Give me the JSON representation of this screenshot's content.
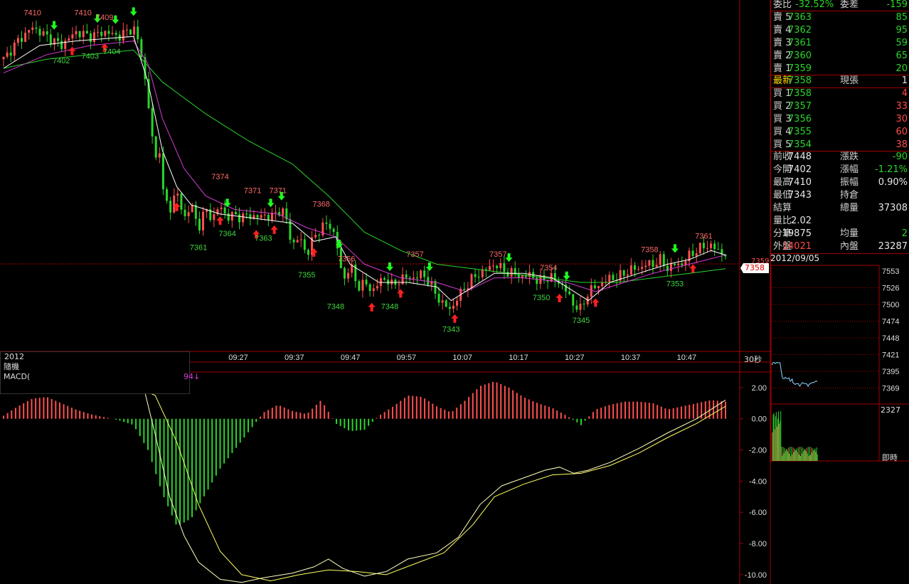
{
  "header": {
    "year": "2012",
    "thirty_sec": "30秒",
    "popup_line1": "隨機",
    "popup_line2": "MACD(",
    "macd_tail": "94↓"
  },
  "sidebar": {
    "top_row": {
      "label": "委比",
      "value": "-32.52%",
      "label2": "委差",
      "value2": "-159"
    },
    "sell": [
      {
        "label": "賣 5",
        "price": "7363",
        "vol": "85"
      },
      {
        "label": "賣 4",
        "price": "7362",
        "vol": "95"
      },
      {
        "label": "賣 3",
        "price": "7361",
        "vol": "59"
      },
      {
        "label": "賣 2",
        "price": "7360",
        "vol": "65"
      },
      {
        "label": "賣 1",
        "price": "7359",
        "vol": "20"
      }
    ],
    "latest": {
      "label": "最新",
      "price": "7358",
      "label2": "現張",
      "vol": "1"
    },
    "buy": [
      {
        "label": "買 1",
        "price": "7358",
        "vol": "4"
      },
      {
        "label": "買 2",
        "price": "7357",
        "vol": "33"
      },
      {
        "label": "買 3",
        "price": "7356",
        "vol": "30"
      },
      {
        "label": "買 4",
        "price": "7355",
        "vol": "60"
      },
      {
        "label": "買 5",
        "price": "7354",
        "vol": "38"
      }
    ],
    "stats": [
      {
        "l1": "前收",
        "v1": "7448",
        "l2": "漲跌",
        "v2": "-90"
      },
      {
        "l1": "今開",
        "v1": "7402",
        "l2": "漲幅",
        "v2": "-1.21%"
      },
      {
        "l1": "最高",
        "v1": "7410",
        "l2": "振幅",
        "v2": "0.90%"
      },
      {
        "l1": "最低",
        "v1": "7343",
        "l2": "持倉",
        "v2": ""
      },
      {
        "l1": "結算",
        "v1": "",
        "l2": "總量",
        "v2": "37308"
      },
      {
        "l1": "量比",
        "v1": "2.02",
        "l2": "",
        "v2": ""
      },
      {
        "l1": "分筆",
        "v1": "19875",
        "l2": "均量",
        "v2": "2"
      },
      {
        "l1": "外盤",
        "v1": "14021",
        "l2": "內盤",
        "v2": "23287"
      }
    ],
    "date": "2012/09/05",
    "mini_ticks": [
      "7553",
      "7526",
      "7500",
      "7474",
      "7448",
      "7421",
      "7395",
      "7369"
    ],
    "mini_vol": "2327",
    "mini_label": "即時"
  },
  "chart_data": {
    "type": "candlestick",
    "price_axis": {
      "ylim": [
        7337,
        7414
      ]
    },
    "current_price_label": "7358",
    "current_price_label2": "7359",
    "time_labels": [
      "09:27",
      "09:37",
      "09:47",
      "09:57",
      "10:07",
      "10:17",
      "10:27",
      "10:37",
      "10:47"
    ],
    "price_annotations": [
      {
        "t": 0.04,
        "v": 7410,
        "text": "7410",
        "pos": "top"
      },
      {
        "t": 0.11,
        "v": 7410,
        "text": "7410",
        "pos": "top"
      },
      {
        "t": 0.14,
        "v": 7409,
        "text": "7409",
        "pos": "top"
      },
      {
        "t": 0.08,
        "v": 7402,
        "text": "7402",
        "pos": "bottom"
      },
      {
        "t": 0.12,
        "v": 7403,
        "text": "7403",
        "pos": "bottom"
      },
      {
        "t": 0.15,
        "v": 7404,
        "text": "7404",
        "pos": "bottom"
      },
      {
        "t": 0.3,
        "v": 7374,
        "text": "7374",
        "pos": "top"
      },
      {
        "t": 0.27,
        "v": 7361,
        "text": "7361",
        "pos": "bottom"
      },
      {
        "t": 0.31,
        "v": 7364,
        "text": "7364",
        "pos": "bottom"
      },
      {
        "t": 0.345,
        "v": 7371,
        "text": "7371",
        "pos": "top"
      },
      {
        "t": 0.38,
        "v": 7371,
        "text": "7371",
        "pos": "top"
      },
      {
        "t": 0.36,
        "v": 7363,
        "text": "7363",
        "pos": "bottom"
      },
      {
        "t": 0.44,
        "v": 7368,
        "text": "7368",
        "pos": "top"
      },
      {
        "t": 0.42,
        "v": 7355,
        "text": "7355",
        "pos": "bottom"
      },
      {
        "t": 0.475,
        "v": 7356,
        "text": "7356",
        "pos": "top"
      },
      {
        "t": 0.46,
        "v": 7348,
        "text": "7348",
        "pos": "bottom"
      },
      {
        "t": 0.535,
        "v": 7348,
        "text": "7348",
        "pos": "bottom"
      },
      {
        "t": 0.57,
        "v": 7357,
        "text": "7357",
        "pos": "top"
      },
      {
        "t": 0.62,
        "v": 7343,
        "text": "7343",
        "pos": "bottom"
      },
      {
        "t": 0.685,
        "v": 7357,
        "text": "7357",
        "pos": "top"
      },
      {
        "t": 0.755,
        "v": 7354,
        "text": "7354",
        "pos": "top"
      },
      {
        "t": 0.745,
        "v": 7350,
        "text": "7350",
        "pos": "bottom"
      },
      {
        "t": 0.8,
        "v": 7345,
        "text": "7345",
        "pos": "bottom"
      },
      {
        "t": 0.895,
        "v": 7358,
        "text": "7358",
        "pos": "top"
      },
      {
        "t": 0.93,
        "v": 7353,
        "text": "7353",
        "pos": "bottom"
      },
      {
        "t": 0.97,
        "v": 7361,
        "text": "7361",
        "pos": "top"
      }
    ],
    "price_path": [
      [
        0.0,
        7401
      ],
      [
        0.02,
        7405
      ],
      [
        0.04,
        7408
      ],
      [
        0.06,
        7406
      ],
      [
        0.08,
        7404
      ],
      [
        0.1,
        7407
      ],
      [
        0.12,
        7406
      ],
      [
        0.14,
        7407
      ],
      [
        0.16,
        7406
      ],
      [
        0.18,
        7408
      ],
      [
        0.19,
        7403
      ],
      [
        0.2,
        7392
      ],
      [
        0.205,
        7385
      ],
      [
        0.21,
        7378
      ],
      [
        0.215,
        7384
      ],
      [
        0.22,
        7372
      ],
      [
        0.23,
        7368
      ],
      [
        0.24,
        7372
      ],
      [
        0.25,
        7366
      ],
      [
        0.26,
        7369
      ],
      [
        0.27,
        7364
      ],
      [
        0.28,
        7368
      ],
      [
        0.29,
        7366
      ],
      [
        0.3,
        7369
      ],
      [
        0.31,
        7366
      ],
      [
        0.32,
        7367
      ],
      [
        0.33,
        7366
      ],
      [
        0.34,
        7367
      ],
      [
        0.35,
        7366
      ],
      [
        0.36,
        7367
      ],
      [
        0.37,
        7366
      ],
      [
        0.38,
        7368
      ],
      [
        0.39,
        7367
      ],
      [
        0.4,
        7360
      ],
      [
        0.41,
        7362
      ],
      [
        0.42,
        7358
      ],
      [
        0.43,
        7362
      ],
      [
        0.44,
        7364
      ],
      [
        0.45,
        7365
      ],
      [
        0.46,
        7362
      ],
      [
        0.47,
        7352
      ],
      [
        0.48,
        7356
      ],
      [
        0.49,
        7351
      ],
      [
        0.5,
        7352
      ],
      [
        0.51,
        7350
      ],
      [
        0.52,
        7352
      ],
      [
        0.53,
        7353
      ],
      [
        0.54,
        7351
      ],
      [
        0.55,
        7353
      ],
      [
        0.56,
        7353
      ],
      [
        0.57,
        7353
      ],
      [
        0.58,
        7354
      ],
      [
        0.59,
        7352
      ],
      [
        0.6,
        7349
      ],
      [
        0.61,
        7347
      ],
      [
        0.62,
        7346
      ],
      [
        0.63,
        7349
      ],
      [
        0.64,
        7351
      ],
      [
        0.65,
        7353
      ],
      [
        0.66,
        7354
      ],
      [
        0.67,
        7355
      ],
      [
        0.68,
        7356
      ],
      [
        0.69,
        7355
      ],
      [
        0.7,
        7354
      ],
      [
        0.71,
        7354
      ],
      [
        0.72,
        7353
      ],
      [
        0.73,
        7354
      ],
      [
        0.74,
        7352
      ],
      [
        0.75,
        7353
      ],
      [
        0.76,
        7353
      ],
      [
        0.77,
        7352
      ],
      [
        0.78,
        7350
      ],
      [
        0.79,
        7347
      ],
      [
        0.8,
        7346
      ],
      [
        0.81,
        7350
      ],
      [
        0.82,
        7351
      ],
      [
        0.83,
        7352
      ],
      [
        0.84,
        7353
      ],
      [
        0.85,
        7353
      ],
      [
        0.86,
        7354
      ],
      [
        0.87,
        7355
      ],
      [
        0.88,
        7355
      ],
      [
        0.89,
        7356
      ],
      [
        0.9,
        7356
      ],
      [
        0.91,
        7357
      ],
      [
        0.92,
        7355
      ],
      [
        0.93,
        7356
      ],
      [
        0.94,
        7356
      ],
      [
        0.95,
        7358
      ],
      [
        0.96,
        7359
      ],
      [
        0.97,
        7360
      ],
      [
        0.98,
        7360
      ],
      [
        0.99,
        7359
      ],
      [
        1.0,
        7358
      ]
    ],
    "ma_fast": [
      [
        0.0,
        7399
      ],
      [
        0.05,
        7404
      ],
      [
        0.1,
        7405
      ],
      [
        0.18,
        7406
      ],
      [
        0.2,
        7396
      ],
      [
        0.22,
        7381
      ],
      [
        0.24,
        7373
      ],
      [
        0.26,
        7369
      ],
      [
        0.3,
        7367
      ],
      [
        0.35,
        7366
      ],
      [
        0.4,
        7365
      ],
      [
        0.43,
        7361
      ],
      [
        0.46,
        7362
      ],
      [
        0.48,
        7356
      ],
      [
        0.52,
        7352
      ],
      [
        0.56,
        7352
      ],
      [
        0.6,
        7351
      ],
      [
        0.62,
        7348
      ],
      [
        0.65,
        7351
      ],
      [
        0.68,
        7354
      ],
      [
        0.72,
        7354
      ],
      [
        0.76,
        7353
      ],
      [
        0.79,
        7350
      ],
      [
        0.81,
        7348
      ],
      [
        0.84,
        7352
      ],
      [
        0.88,
        7354
      ],
      [
        0.92,
        7356
      ],
      [
        0.95,
        7357
      ],
      [
        0.98,
        7359
      ],
      [
        1.0,
        7358
      ]
    ],
    "ma_mid": [
      [
        0.0,
        7398
      ],
      [
        0.06,
        7402
      ],
      [
        0.12,
        7404
      ],
      [
        0.18,
        7405
      ],
      [
        0.2,
        7400
      ],
      [
        0.22,
        7388
      ],
      [
        0.25,
        7377
      ],
      [
        0.28,
        7371
      ],
      [
        0.32,
        7368
      ],
      [
        0.38,
        7367
      ],
      [
        0.42,
        7364
      ],
      [
        0.46,
        7362
      ],
      [
        0.5,
        7356
      ],
      [
        0.55,
        7353
      ],
      [
        0.6,
        7352
      ],
      [
        0.64,
        7350
      ],
      [
        0.68,
        7353
      ],
      [
        0.72,
        7353
      ],
      [
        0.78,
        7352
      ],
      [
        0.82,
        7350
      ],
      [
        0.86,
        7352
      ],
      [
        0.9,
        7354
      ],
      [
        0.95,
        7356
      ],
      [
        1.0,
        7358
      ]
    ],
    "ma_slow": [
      [
        0.0,
        7399
      ],
      [
        0.06,
        7401
      ],
      [
        0.12,
        7402
      ],
      [
        0.18,
        7403
      ],
      [
        0.22,
        7396
      ],
      [
        0.28,
        7389
      ],
      [
        0.34,
        7383
      ],
      [
        0.4,
        7378
      ],
      [
        0.45,
        7371
      ],
      [
        0.5,
        7363
      ],
      [
        0.55,
        7359
      ],
      [
        0.6,
        7356
      ],
      [
        0.65,
        7355
      ],
      [
        0.7,
        7354
      ],
      [
        0.75,
        7353
      ],
      [
        0.8,
        7352
      ],
      [
        0.85,
        7352
      ],
      [
        0.9,
        7353
      ],
      [
        0.95,
        7354
      ],
      [
        1.0,
        7355
      ]
    ],
    "buy_arrows": [
      0.095,
      0.14,
      0.24,
      0.3,
      0.35,
      0.375,
      0.43,
      0.51,
      0.55,
      0.625,
      0.77,
      0.82,
      0.955
    ],
    "sell_arrows": [
      0.07,
      0.13,
      0.155,
      0.18,
      0.31,
      0.37,
      0.385,
      0.465,
      0.535,
      0.59,
      0.7,
      0.78,
      0.93
    ],
    "macd_axis": {
      "ylim": [
        -10.6,
        3.0
      ],
      "ticks": [
        "2.00",
        "0.00",
        "-2.00",
        "-4.00",
        "-6.00",
        "-8.00",
        "-10.00"
      ]
    },
    "macd_hist": [
      [
        0.0,
        0.2
      ],
      [
        0.02,
        0.8
      ],
      [
        0.04,
        1.3
      ],
      [
        0.06,
        1.4
      ],
      [
        0.08,
        1.0
      ],
      [
        0.1,
        0.6
      ],
      [
        0.12,
        0.3
      ],
      [
        0.14,
        0.1
      ],
      [
        0.16,
        -0.1
      ],
      [
        0.18,
        -0.4
      ],
      [
        0.2,
        -2.0
      ],
      [
        0.22,
        -4.8
      ],
      [
        0.24,
        -6.9
      ],
      [
        0.26,
        -6.4
      ],
      [
        0.28,
        -4.8
      ],
      [
        0.3,
        -3.2
      ],
      [
        0.32,
        -2.0
      ],
      [
        0.34,
        -0.8
      ],
      [
        0.36,
        0.4
      ],
      [
        0.38,
        0.9
      ],
      [
        0.4,
        0.5
      ],
      [
        0.42,
        0.3
      ],
      [
        0.44,
        1.2
      ],
      [
        0.46,
        -0.3
      ],
      [
        0.48,
        -0.8
      ],
      [
        0.5,
        -0.7
      ],
      [
        0.52,
        0.2
      ],
      [
        0.54,
        0.8
      ],
      [
        0.56,
        1.5
      ],
      [
        0.58,
        1.4
      ],
      [
        0.6,
        0.8
      ],
      [
        0.62,
        0.4
      ],
      [
        0.64,
        1.2
      ],
      [
        0.66,
        2.1
      ],
      [
        0.68,
        2.4
      ],
      [
        0.7,
        2.0
      ],
      [
        0.72,
        1.4
      ],
      [
        0.74,
        1.0
      ],
      [
        0.76,
        0.7
      ],
      [
        0.78,
        0.2
      ],
      [
        0.8,
        -0.4
      ],
      [
        0.82,
        0.6
      ],
      [
        0.84,
        0.9
      ],
      [
        0.86,
        1.1
      ],
      [
        0.88,
        1.1
      ],
      [
        0.9,
        1.0
      ],
      [
        0.92,
        0.6
      ],
      [
        0.94,
        0.8
      ],
      [
        0.96,
        1.0
      ],
      [
        0.98,
        1.2
      ],
      [
        1.0,
        1.1
      ]
    ],
    "macd_dif": [
      [
        0.19,
        2.8
      ],
      [
        0.21,
        -1.0
      ],
      [
        0.23,
        -5.0
      ],
      [
        0.25,
        -7.5
      ],
      [
        0.27,
        -9.2
      ],
      [
        0.3,
        -10.3
      ],
      [
        0.33,
        -10.5
      ],
      [
        0.36,
        -10.2
      ],
      [
        0.4,
        -9.9
      ],
      [
        0.43,
        -9.5
      ],
      [
        0.45,
        -9.0
      ],
      [
        0.47,
        -9.6
      ],
      [
        0.5,
        -10.1
      ],
      [
        0.53,
        -9.8
      ],
      [
        0.56,
        -9.0
      ],
      [
        0.6,
        -8.6
      ],
      [
        0.63,
        -7.6
      ],
      [
        0.66,
        -5.5
      ],
      [
        0.69,
        -4.3
      ],
      [
        0.72,
        -3.8
      ],
      [
        0.75,
        -3.3
      ],
      [
        0.77,
        -3.1
      ],
      [
        0.79,
        -3.5
      ],
      [
        0.81,
        -3.3
      ],
      [
        0.84,
        -2.8
      ],
      [
        0.88,
        -1.9
      ],
      [
        0.92,
        -0.9
      ],
      [
        0.96,
        0.0
      ],
      [
        1.0,
        1.2
      ]
    ],
    "macd_dea": [
      [
        0.08,
        2.6
      ],
      [
        0.16,
        2.5
      ],
      [
        0.21,
        1.5
      ],
      [
        0.24,
        -1.5
      ],
      [
        0.27,
        -5.5
      ],
      [
        0.3,
        -8.5
      ],
      [
        0.33,
        -10.0
      ],
      [
        0.37,
        -10.4
      ],
      [
        0.41,
        -10.0
      ],
      [
        0.45,
        -9.7
      ],
      [
        0.49,
        -9.8
      ],
      [
        0.53,
        -10.0
      ],
      [
        0.57,
        -9.3
      ],
      [
        0.61,
        -8.6
      ],
      [
        0.65,
        -6.8
      ],
      [
        0.68,
        -5.0
      ],
      [
        0.72,
        -4.2
      ],
      [
        0.76,
        -3.6
      ],
      [
        0.8,
        -3.5
      ],
      [
        0.84,
        -3.0
      ],
      [
        0.88,
        -2.2
      ],
      [
        0.92,
        -1.2
      ],
      [
        0.96,
        -0.3
      ],
      [
        1.0,
        0.8
      ]
    ],
    "colors": {
      "up": "#ff5050",
      "down": "#2ad52a",
      "ma_fast": "#ffffff",
      "ma_mid": "#d83cd8",
      "ma_slow": "#2ad52a",
      "dif": "#ffffc0",
      "dea": "#ffff60",
      "border": "#a00000",
      "ref": "#c00000"
    }
  }
}
